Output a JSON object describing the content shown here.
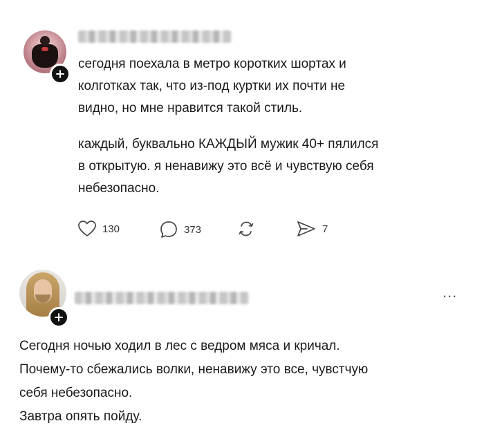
{
  "post1": {
    "paragraph1": "сегодня поехала в метро коротких шортах и\nколготках так, что из-под куртки их почти не\nвидно, но мне нравится такой стиль.",
    "paragraph2": "каждый, буквально КАЖДЫЙ мужик 40+ пялился\nв открытую. я ненавижу это всё и чувствую себя\nнебезопасно.",
    "likes": "130",
    "comments": "373",
    "shares": "7"
  },
  "post2": {
    "text": "Сегодня ночью ходил в лес с ведром мяса и кричал.\nПочему-то сбежались волки, ненавижу это все, чувстчую\nсебя небезопасно.\nЗавтра опять пойду.",
    "more": "..."
  },
  "icons": {
    "like": "heart-icon",
    "comment": "comment-bubble-icon",
    "repost": "repost-icon",
    "share": "share-icon",
    "follow": "plus-icon"
  }
}
